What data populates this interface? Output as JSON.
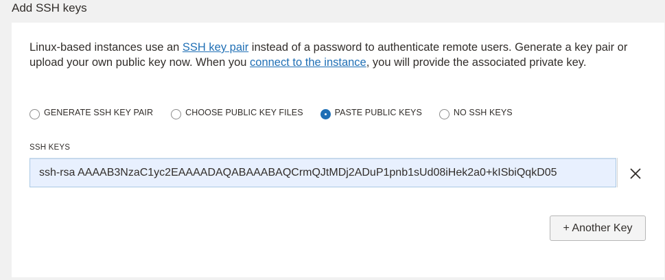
{
  "section": {
    "title": "Add SSH keys"
  },
  "description": {
    "part1": "Linux-based instances use an ",
    "link1": "SSH key pair",
    "part2": " instead of a password to authenticate remote users. Generate a key pair or upload your own public key now. When you ",
    "link2": "connect to the instance",
    "part3": ", you will provide the associated private key."
  },
  "radio_options": [
    {
      "label": "GENERATE SSH KEY PAIR",
      "checked": false
    },
    {
      "label": "CHOOSE PUBLIC KEY FILES",
      "checked": false
    },
    {
      "label": "PASTE PUBLIC KEYS",
      "checked": true
    },
    {
      "label": "NO SSH KEYS",
      "checked": false
    }
  ],
  "ssh_keys": {
    "label": "SSH KEYS",
    "value": "ssh-rsa AAAAB3NzaC1yc2EAAAADAQABAAABAQCrmQJtMDj2ADuP1pnb1sUd08iHek2a0+kISbiQqkD05"
  },
  "actions": {
    "another_key_label": "+ Another Key"
  },
  "colors": {
    "link": "#1f6fb5",
    "radio_selected": "#1f6fb5",
    "input_background": "#e8f0fe",
    "page_background": "#f1f1f1"
  }
}
